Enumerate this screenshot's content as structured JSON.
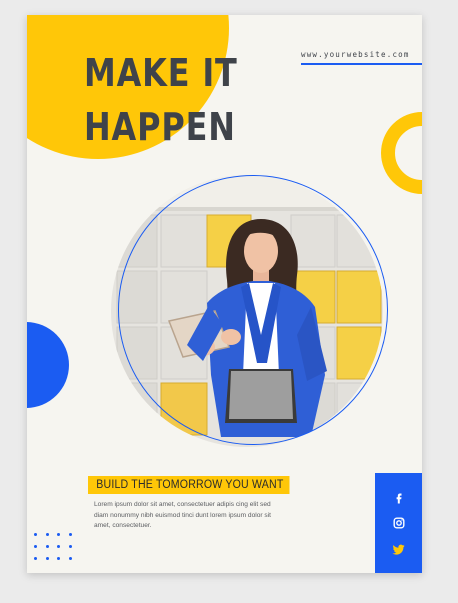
{
  "headline": {
    "line1": "MAKE IT",
    "line2": "HAPPEN"
  },
  "website": "www.yourwebsite.com",
  "tagline": "BUILD THE TOMORROW YOU WANT",
  "body_text": "Lorem ipsum dolor sit amet, consectetuer adipis cing elit sed diam nonummy nibh euismod tinci dunt lorem ipsum dolor sit amet, consectetuer.",
  "social": {
    "icons": [
      "facebook-icon",
      "instagram-icon",
      "twitter-icon"
    ]
  },
  "colors": {
    "accent_yellow": "#ffc708",
    "accent_blue": "#1b5cf2",
    "text_dark": "#3f434a",
    "poster_bg": "#f6f5f0"
  },
  "photo": {
    "subject": "woman-in-blue-blazer-holding-tablet"
  }
}
